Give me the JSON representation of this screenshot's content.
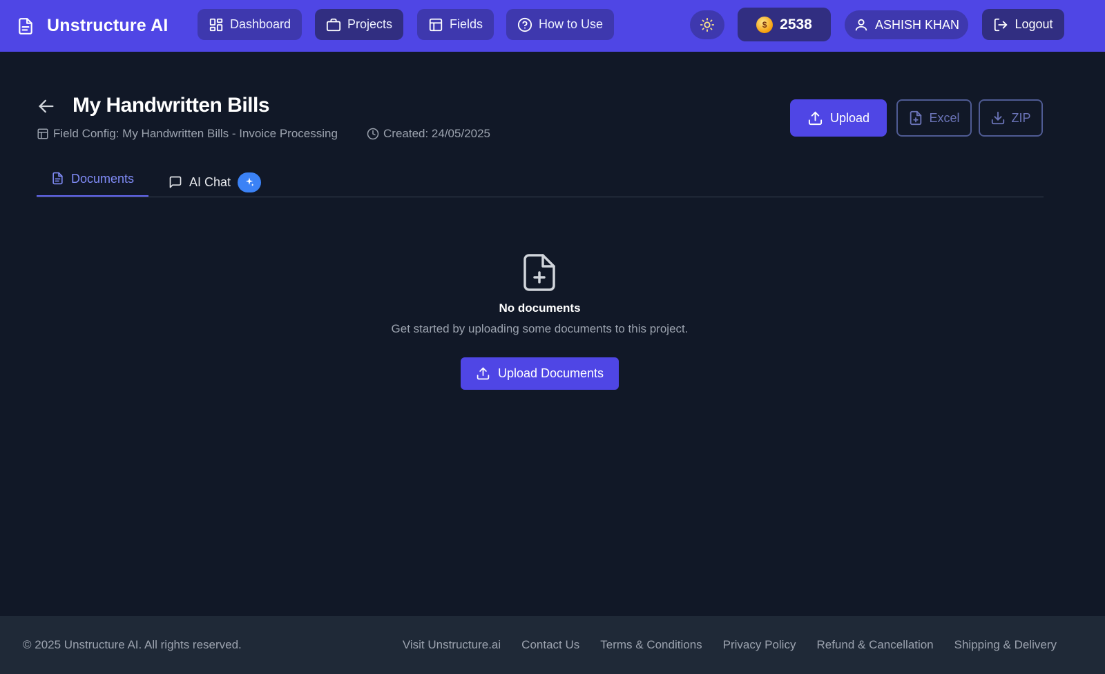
{
  "header": {
    "brand": "Unstructure AI",
    "nav": [
      {
        "label": "Dashboard",
        "icon": "dashboard-grid-icon"
      },
      {
        "label": "Projects",
        "icon": "briefcase-icon",
        "active": true
      },
      {
        "label": "Fields",
        "icon": "table-icon"
      },
      {
        "label": "How to Use",
        "icon": "help-circle-icon"
      }
    ],
    "theme_icon": "sun-icon",
    "credits": "2538",
    "coin_symbol": "$",
    "user_name": "ASHISH KHAN",
    "logout_label": "Logout"
  },
  "project": {
    "title": "My Handwritten Bills",
    "field_config": "Field Config: My Handwritten Bills - Invoice Processing",
    "created": "Created: 24/05/2025"
  },
  "actions": {
    "upload": "Upload",
    "excel": "Excel",
    "zip": "ZIP"
  },
  "tabs": {
    "documents": "Documents",
    "ai_chat": "AI Chat"
  },
  "empty_state": {
    "title": "No documents",
    "subtitle": "Get started by uploading some documents to this project.",
    "button": "Upload Documents"
  },
  "footer": {
    "copyright": "© 2025 Unstructure AI. All rights reserved.",
    "links": [
      "Visit Unstructure.ai",
      "Contact Us",
      "Terms & Conditions",
      "Privacy Policy",
      "Refund & Cancellation",
      "Shipping & Delivery"
    ]
  },
  "colors": {
    "header_bg": "#4f46e5",
    "page_bg": "#111827",
    "accent": "#6366f1",
    "footer_bg": "#1f2937"
  }
}
